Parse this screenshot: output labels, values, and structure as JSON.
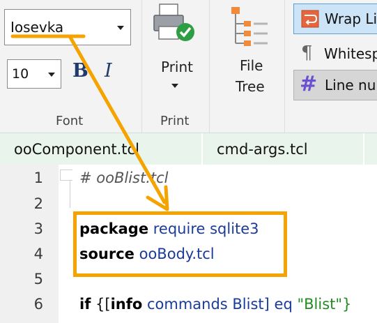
{
  "ribbon": {
    "font_group": {
      "label": "Font",
      "font_name": "Iosevka",
      "font_size": "10",
      "bold_label": "B",
      "italic_label": "I"
    },
    "print_group": {
      "label": "Print",
      "print_button": "Print"
    },
    "file_tree": {
      "line1": "File",
      "line2": "Tree"
    },
    "view_toggles": {
      "wrap_lines": "Wrap Lin",
      "whitespace": "Whitesp",
      "line_numbers": "Line nur"
    }
  },
  "tabs": [
    {
      "label": "ooComponent.tcl"
    },
    {
      "label": "cmd-args.tcl"
    }
  ],
  "editor": {
    "line_numbers": [
      "1",
      "2",
      "3",
      "4",
      "5",
      "6"
    ],
    "lines": [
      {
        "comment": "# ooBlist.tcl"
      },
      {},
      {
        "kw": "package",
        "rest": " require sqlite3"
      },
      {
        "kw": "source",
        "rest": " ooBody.tcl"
      },
      {},
      {
        "kw": "if",
        "p1": " {[",
        "kw2": "info",
        "rest": " commands Blist] ",
        "kw3": "eq",
        "str": " \"Blist\"}"
      }
    ]
  },
  "colors": {
    "annotation": "#f5a300",
    "wrap_active_bg": "#cce4f7",
    "tab_bg": "#e9f5ec"
  }
}
